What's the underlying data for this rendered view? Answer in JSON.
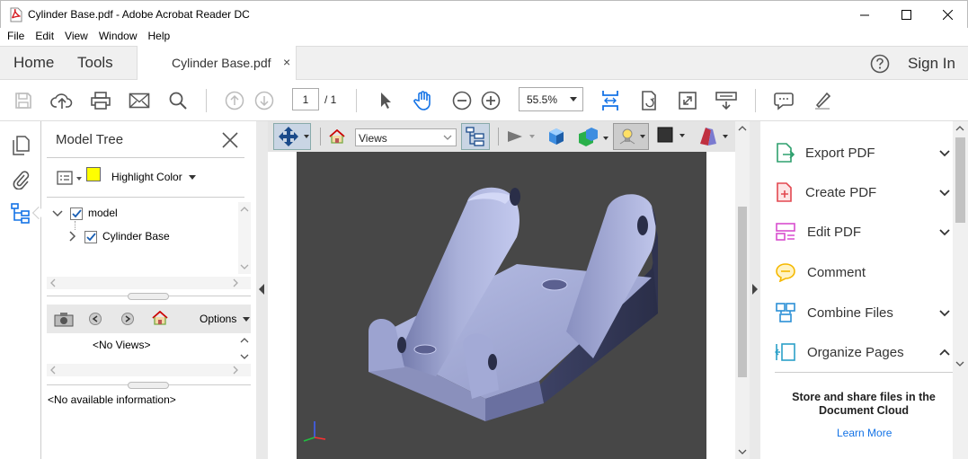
{
  "window": {
    "title": "Cylinder Base.pdf - Adobe Acrobat Reader DC",
    "minimize_icon": "minimize-icon",
    "maximize_icon": "maximize-icon",
    "close_icon": "close-icon"
  },
  "menu": [
    "File",
    "Edit",
    "View",
    "Window",
    "Help"
  ],
  "tabs": {
    "home": "Home",
    "tools": "Tools",
    "document": "Cylinder Base.pdf",
    "close": "×"
  },
  "header": {
    "sign_in": "Sign In"
  },
  "toolbar": {
    "page_current": "1",
    "page_total": "/ 1",
    "zoom": "55.5%"
  },
  "left_panel": {
    "title": "Model Tree",
    "highlight_color_label": "Highlight Color",
    "highlight_color": "#ffff00",
    "tree": [
      {
        "label": "model",
        "checked": true,
        "expanded": true
      },
      {
        "label": "Cylinder Base",
        "checked": true,
        "expanded": false
      }
    ],
    "options_label": "Options",
    "no_views": "<No Views>",
    "no_info": "<No available information>"
  },
  "toolbar_3d": {
    "views_select": "Views"
  },
  "right_panel": {
    "items": [
      {
        "label": "Export PDF",
        "chevron": "down",
        "icon": "export-pdf-icon",
        "color": "#2fa06e"
      },
      {
        "label": "Create PDF",
        "chevron": "down",
        "icon": "create-pdf-icon",
        "color": "#e34850"
      },
      {
        "label": "Edit PDF",
        "chevron": "down",
        "icon": "edit-pdf-icon",
        "color": "#d94ecf"
      },
      {
        "label": "Comment",
        "chevron": "",
        "icon": "comment-icon",
        "color": "#f5b800"
      },
      {
        "label": "Combine Files",
        "chevron": "down",
        "icon": "combine-files-icon",
        "color": "#2b8fd6"
      },
      {
        "label": "Organize Pages",
        "chevron": "up",
        "icon": "organize-pages-icon",
        "color": "#2ba0c8"
      }
    ],
    "cloud_text": "Store and share files in the Document Cloud",
    "learn_more": "Learn More"
  },
  "colors": {
    "accent_blue": "#1473e6",
    "viewport_bg": "#474747",
    "model_color": "#a9b0d9"
  }
}
